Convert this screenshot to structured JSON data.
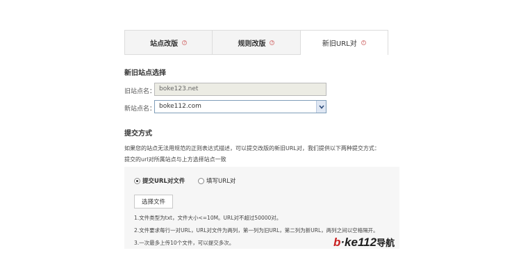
{
  "tabs": [
    {
      "label": "站点改版",
      "help": "?"
    },
    {
      "label": "规则改版",
      "help": "?"
    },
    {
      "label": "新旧URL对",
      "help": "?"
    }
  ],
  "site_select": {
    "title": "新旧站点选择",
    "old_label": "旧站点名：",
    "old_value": "boke123.net",
    "new_label": "新站点名：",
    "new_value": "boke112.com"
  },
  "submit": {
    "title": "提交方式",
    "desc_line1": "如果您的站点无法用规范的正则表达式描述，可以提交改版的新旧URL对，我们提供以下两种提交方式：",
    "desc_line2": "提交的url对所属站点与上方选择站点一致",
    "radio_file": "提交URL对文件",
    "radio_manual": "填写URL对",
    "choose_file": "选择文件",
    "notes": [
      "1.文件类型为txt，文件大小<=10M。URL对不超过50000对。",
      "2.文件要求每行一对URL，URL对文件为两列，第一列为旧URL，第二列为新URL，两列之间以空格隔开。",
      "3.一次最多上传10个文件，可以提交多次。"
    ]
  },
  "watermark": {
    "part1": "b",
    "part2": "·ke112",
    "part3": "导航"
  }
}
